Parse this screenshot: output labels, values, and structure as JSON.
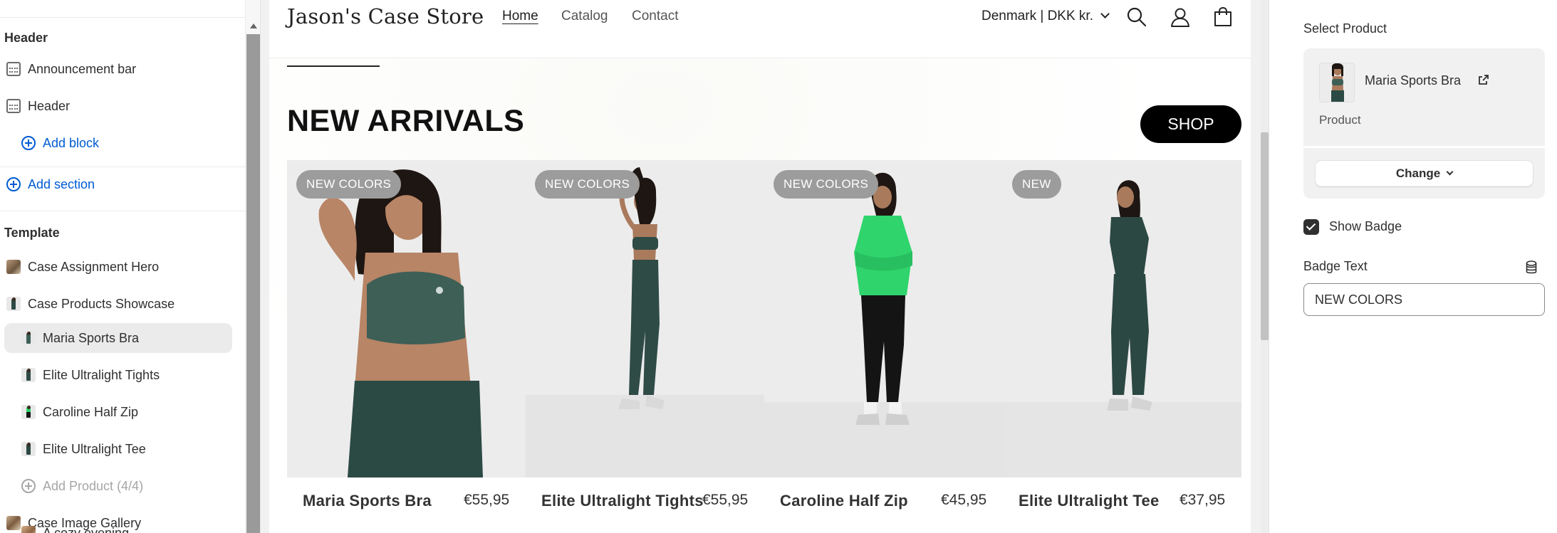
{
  "left_panel": {
    "header_group": {
      "title": "Header",
      "items": [
        "Announcement bar",
        "Header"
      ],
      "add_block": "Add block"
    },
    "add_section": "Add section",
    "template_group": {
      "title": "Template",
      "hero": "Case Assignment Hero",
      "showcase": "Case Products Showcase",
      "showcase_items": [
        "Maria Sports Bra",
        "Elite Ultralight Tights",
        "Caroline Half Zip",
        "Elite Ultralight Tee"
      ],
      "add_product": "Add Product (4/4)",
      "gallery": "Case Image Gallery",
      "gallery_items": [
        "A cozy evening"
      ]
    },
    "selected_item": "Maria Sports Bra"
  },
  "store": {
    "brand": "Jason's Case Store",
    "nav": [
      "Home",
      "Catalog",
      "Contact"
    ],
    "active_nav": "Home",
    "locale": "Denmark | DKK kr.",
    "icons": [
      "search-icon",
      "account-icon",
      "cart-icon"
    ]
  },
  "section": {
    "title": "NEW ARRIVALS",
    "button": "SHOP",
    "products": [
      {
        "badge": "NEW COLORS",
        "name": "Maria Sports Bra",
        "price": "€55,95",
        "top_color": "#3e5f56",
        "bottom_color": "#2c4a44"
      },
      {
        "badge": "NEW COLORS",
        "name": "Elite Ultralight Tights",
        "price": "€55,95",
        "top_color": "#2f4b46",
        "bottom_color": "#2f4b46"
      },
      {
        "badge": "NEW COLORS",
        "name": "Caroline Half Zip",
        "price": "€45,95",
        "top_color": "#2fd46c",
        "bottom_color": "#141414"
      },
      {
        "badge": "NEW",
        "name": "Elite Ultralight Tee",
        "price": "€37,95",
        "top_color": "#2c4843",
        "bottom_color": "#2c4843"
      }
    ]
  },
  "right_panel": {
    "select_product_label": "Select Product",
    "product_name": "Maria Sports Bra",
    "product_type": "Product",
    "change_button": "Change",
    "show_badge_label": "Show Badge",
    "show_badge_checked": true,
    "badge_text_label": "Badge Text",
    "badge_text_value": "NEW COLORS"
  },
  "colors": {
    "accent_link": "#005bd3",
    "badge_bg": "#9c9c9c",
    "shop_button_bg": "#000000"
  }
}
